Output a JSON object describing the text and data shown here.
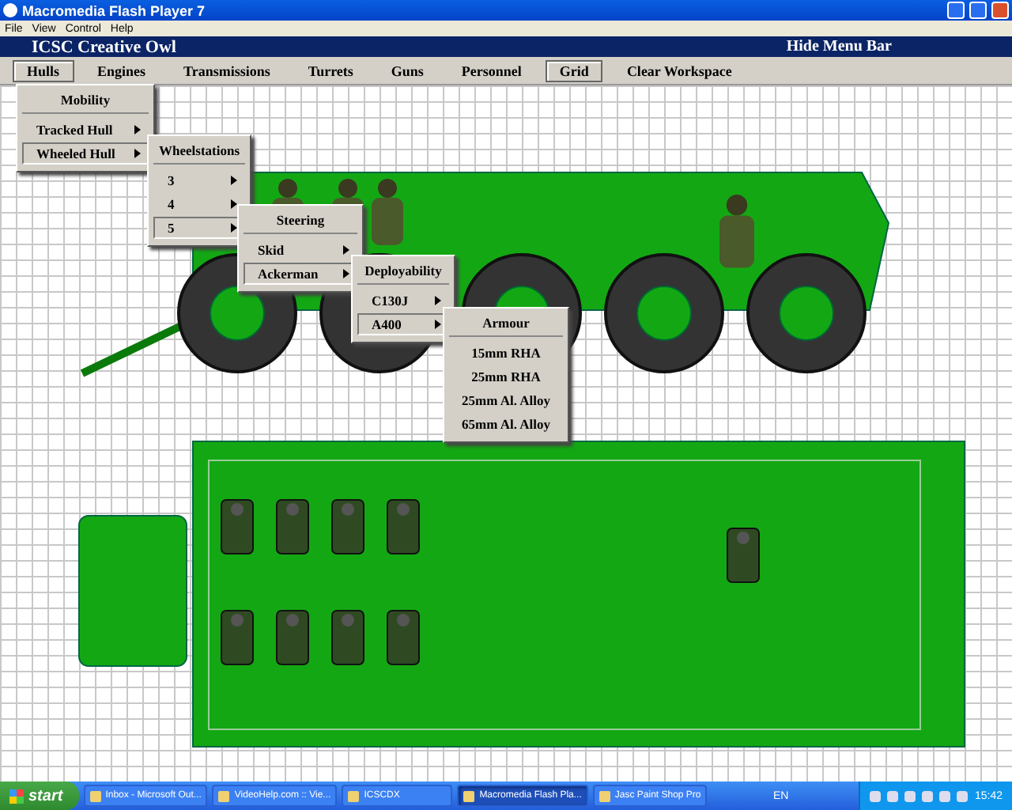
{
  "window": {
    "title": "Macromedia Flash Player 7"
  },
  "menu_bar": [
    "File",
    "View",
    "Control",
    "Help"
  ],
  "header": {
    "title": "ICSC Creative Owl",
    "action": "Hide Menu Bar"
  },
  "tabs": [
    {
      "label": "Hulls",
      "active": true
    },
    {
      "label": "Engines",
      "active": false
    },
    {
      "label": "Transmissions",
      "active": false
    },
    {
      "label": "Turrets",
      "active": false
    },
    {
      "label": "Guns",
      "active": false
    },
    {
      "label": "Personnel",
      "active": false
    },
    {
      "label": "Grid",
      "active": true
    },
    {
      "label": "Clear Workspace",
      "active": false
    }
  ],
  "menus": [
    {
      "heading": "Mobility",
      "items": [
        {
          "label": "Tracked Hull",
          "selected": false,
          "submenu": true
        },
        {
          "label": "Wheeled Hull",
          "selected": true,
          "submenu": true
        }
      ]
    },
    {
      "heading": "Wheelstations",
      "items": [
        {
          "label": "3",
          "selected": false,
          "submenu": true
        },
        {
          "label": "4",
          "selected": false,
          "submenu": true
        },
        {
          "label": "5",
          "selected": true,
          "submenu": true
        }
      ]
    },
    {
      "heading": "Steering",
      "items": [
        {
          "label": "Skid",
          "selected": false,
          "submenu": true
        },
        {
          "label": "Ackerman",
          "selected": true,
          "submenu": true
        }
      ]
    },
    {
      "heading": "Deployability",
      "items": [
        {
          "label": "C130J",
          "selected": false,
          "submenu": true
        },
        {
          "label": "A400",
          "selected": true,
          "submenu": true
        }
      ]
    },
    {
      "heading": "Armour",
      "items": [
        {
          "label": "15mm RHA",
          "selected": false,
          "submenu": false
        },
        {
          "label": "25mm RHA",
          "selected": false,
          "submenu": false
        },
        {
          "label": "25mm Al. Alloy",
          "selected": false,
          "submenu": false
        },
        {
          "label": "65mm Al. Alloy",
          "selected": false,
          "submenu": false
        }
      ]
    }
  ],
  "taskbar": {
    "start": "start",
    "tasks": [
      {
        "label": "Inbox - Microsoft Out...",
        "active": false
      },
      {
        "label": "VideoHelp.com :: Vie...",
        "active": false
      },
      {
        "label": "ICSCDX",
        "active": false
      },
      {
        "label": "Macromedia Flash Pla...",
        "active": true
      },
      {
        "label": "Jasc Paint Shop Pro",
        "active": false
      }
    ],
    "language": "EN",
    "clock": "15:42"
  }
}
